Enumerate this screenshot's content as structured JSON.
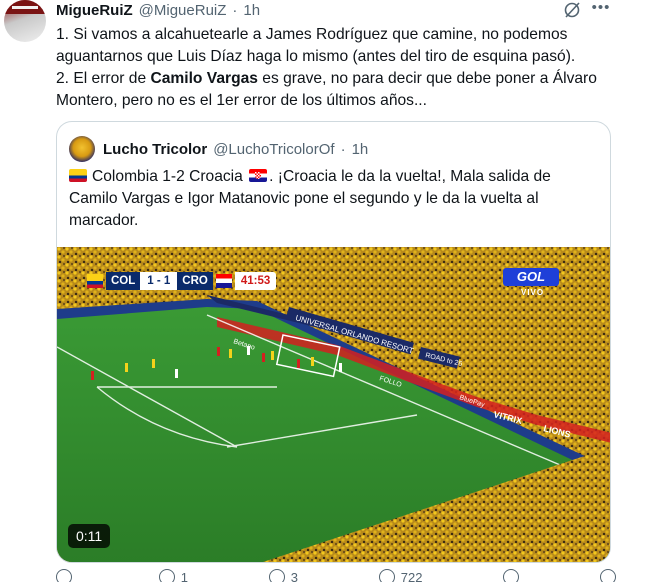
{
  "tweet": {
    "name": "MigueRuiZ",
    "handle": "@MigueRuiZ",
    "separator": "·",
    "time": "1h",
    "line1": "1. Si vamos a alcahuetearle a James Rodríguez que camine, no podemos aguantarnos que Luis Díaz haga lo mismo (antes del tiro de esquina pasó).",
    "line2_pre": "2. El error de ",
    "line2_bold": "Camilo Vargas",
    "line2_post": " es grave, no para decir que debe poner a Álvaro Montero, pero no es el 1er error de los últimos años..."
  },
  "quote": {
    "name": "Lucho Tricolor",
    "handle": "@LuchoTricolorOf",
    "separator": "·",
    "time": "1h",
    "text_a": "Colombia 1-2 Croacia ",
    "text_b": ". ¡Croacia le da la vuelta!, Mala salida de Camilo Vargas e Igor Matanovic pone el segundo y le da la vuelta al marcador."
  },
  "video": {
    "score_home": "COL",
    "score": "1 - 1",
    "score_away": "CRO",
    "clock": "41:53",
    "broadcaster": "GOL",
    "broadcaster_sub": "VIVO",
    "duration": "0:11",
    "signage": [
      "UNIVERSAL ORLANDO RESORT",
      "Betano",
      "ROAD to 26",
      "VITRIX",
      "LIONS",
      "BluePay",
      "FOLLO"
    ]
  },
  "actions": {
    "replies": "",
    "reposts": "1",
    "likes": "3",
    "views": "722"
  },
  "colors": {
    "text": "#0f1419",
    "muted": "#536471",
    "border": "#cfd9de",
    "pitch": "#2f8a2c"
  },
  "icons": [
    "grok-icon",
    "more-icon",
    "reply-icon",
    "repost-icon",
    "like-icon",
    "views-icon",
    "bookmark-icon",
    "share-icon"
  ]
}
